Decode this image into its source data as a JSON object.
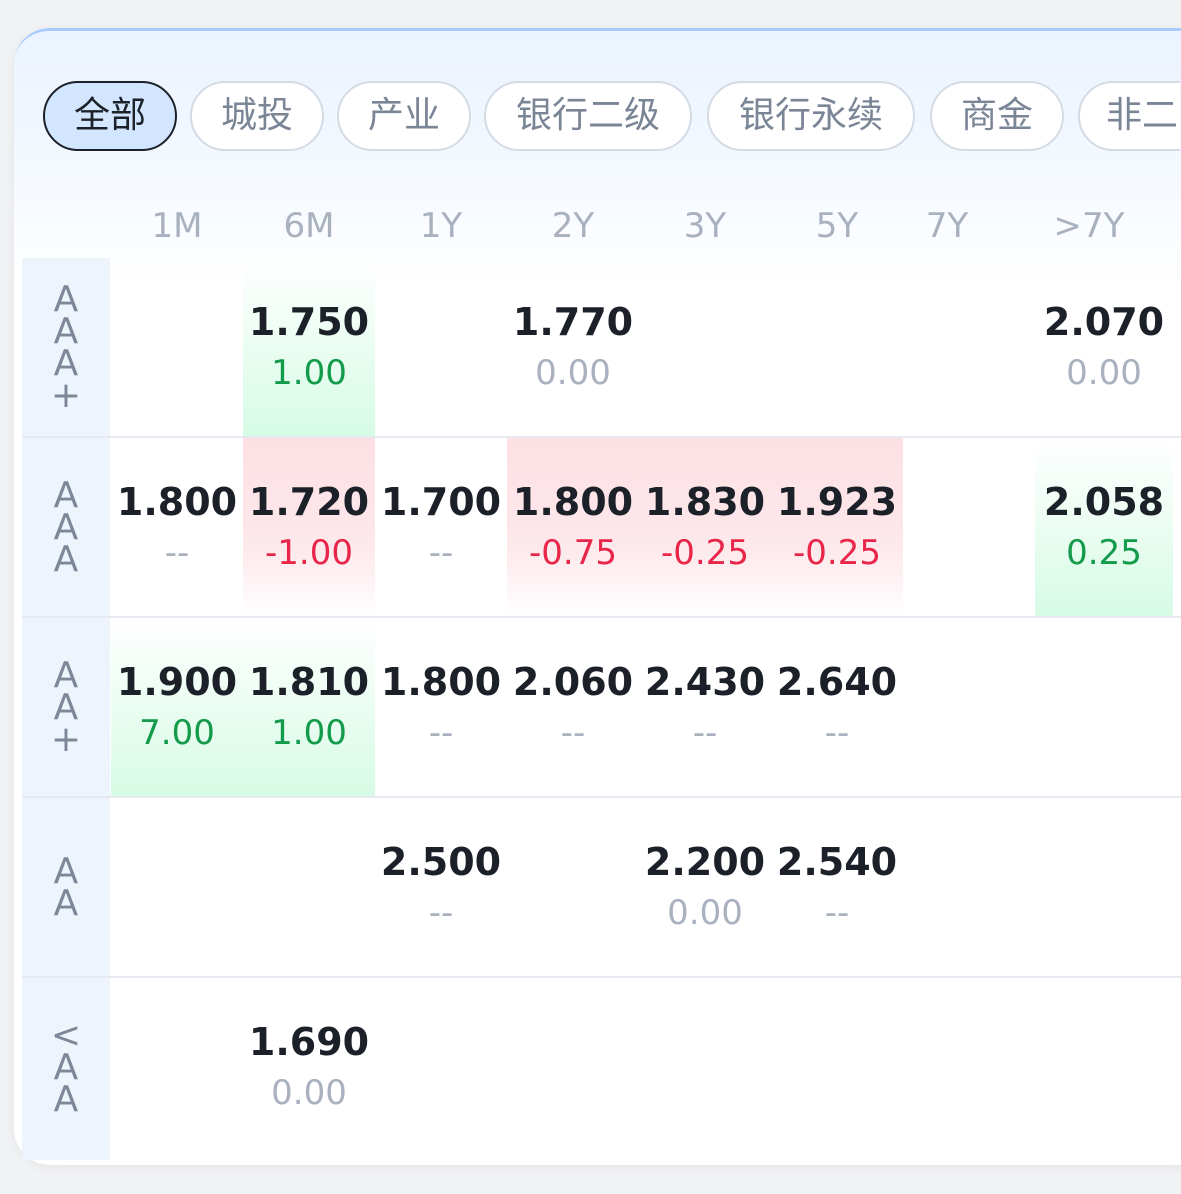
{
  "tabs": [
    "全部",
    "城投",
    "产业",
    "银行二级",
    "银行永续",
    "商金",
    "非二"
  ],
  "columns": [
    "1M",
    "6M",
    "1Y",
    "2Y",
    "3Y",
    "5Y",
    "7Y",
    ">7Y"
  ],
  "rows": [
    {
      "label": [
        "A",
        "A",
        "A",
        "+"
      ],
      "cells": [
        null,
        {
          "val": "1.750",
          "chg": "1.00",
          "tone": "pos"
        },
        null,
        {
          "val": "1.770",
          "chg": "0.00",
          "tone": "zero"
        },
        null,
        null,
        null,
        {
          "val": "2.070",
          "chg": "0.00",
          "tone": "zero"
        }
      ]
    },
    {
      "label": [
        "A",
        "A",
        "A"
      ],
      "cells": [
        {
          "val": "1.800",
          "chg": "--",
          "tone": "zero"
        },
        {
          "val": "1.720",
          "chg": "-1.00",
          "tone": "neg"
        },
        {
          "val": "1.700",
          "chg": "--",
          "tone": "zero"
        },
        {
          "val": "1.800",
          "chg": "-0.75",
          "tone": "neg"
        },
        {
          "val": "1.830",
          "chg": "-0.25",
          "tone": "neg"
        },
        {
          "val": "1.923",
          "chg": "-0.25",
          "tone": "neg"
        },
        null,
        {
          "val": "2.058",
          "chg": "0.25",
          "tone": "pos"
        }
      ]
    },
    {
      "label": [
        "A",
        "A",
        "+"
      ],
      "cells": [
        {
          "val": "1.900",
          "chg": "7.00",
          "tone": "pos"
        },
        {
          "val": "1.810",
          "chg": "1.00",
          "tone": "pos"
        },
        {
          "val": "1.800",
          "chg": "--",
          "tone": "zero"
        },
        {
          "val": "2.060",
          "chg": "--",
          "tone": "zero"
        },
        {
          "val": "2.430",
          "chg": "--",
          "tone": "zero"
        },
        {
          "val": "2.640",
          "chg": "--",
          "tone": "zero"
        },
        null,
        null
      ]
    },
    {
      "label": [
        "A",
        "A"
      ],
      "cells": [
        null,
        null,
        {
          "val": "2.500",
          "chg": "--",
          "tone": "zero"
        },
        null,
        {
          "val": "2.200",
          "chg": "0.00",
          "tone": "zero"
        },
        {
          "val": "2.540",
          "chg": "--",
          "tone": "zero"
        },
        null,
        null
      ]
    },
    {
      "label": [
        "<",
        "A",
        "A"
      ],
      "cells": [
        null,
        {
          "val": "1.690",
          "chg": "0.00",
          "tone": "zero"
        },
        null,
        null,
        null,
        null,
        null,
        null
      ]
    }
  ]
}
